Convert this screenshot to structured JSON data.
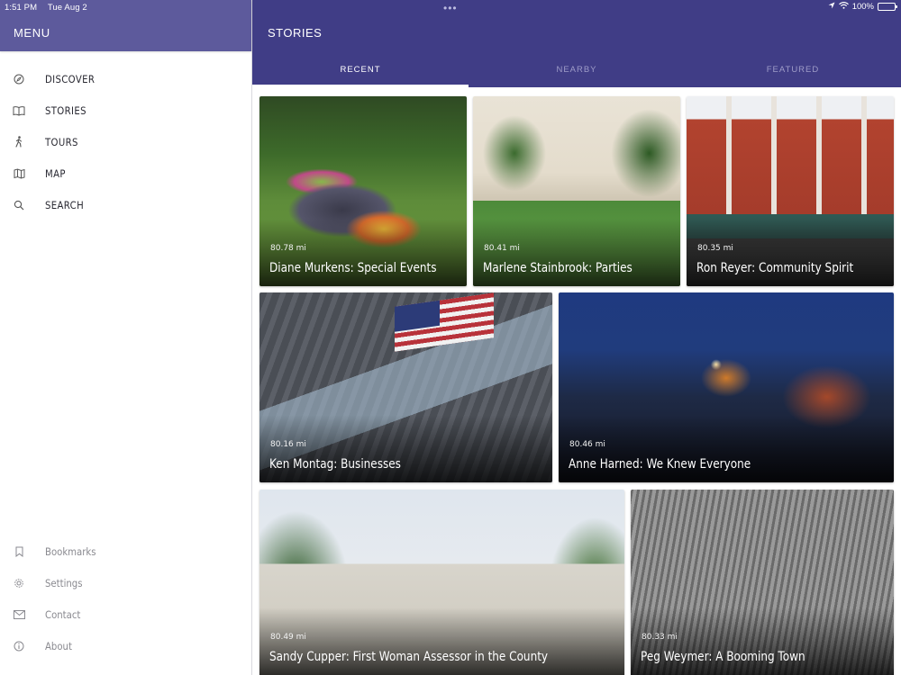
{
  "status_bar": {
    "time": "1:51 PM",
    "date": "Tue Aug 2",
    "battery": "100%",
    "battery_level": 1.0
  },
  "sidebar": {
    "title": "MENU",
    "main_items": [
      {
        "label": "DISCOVER",
        "icon": "compass-icon"
      },
      {
        "label": "STORIES",
        "icon": "book-icon"
      },
      {
        "label": "TOURS",
        "icon": "walking-person-icon"
      },
      {
        "label": "MAP",
        "icon": "map-icon"
      },
      {
        "label": "SEARCH",
        "icon": "search-icon"
      }
    ],
    "secondary_items": [
      {
        "label": "Bookmarks",
        "icon": "bookmark-icon"
      },
      {
        "label": "Settings",
        "icon": "gear-icon"
      },
      {
        "label": "Contact",
        "icon": "envelope-icon"
      },
      {
        "label": "About",
        "icon": "info-icon"
      }
    ]
  },
  "header": {
    "title": "STORIES",
    "tabs": [
      {
        "label": "RECENT",
        "active": true
      },
      {
        "label": "NEARBY",
        "active": false
      },
      {
        "label": "FEATURED",
        "active": false
      }
    ]
  },
  "stories": [
    {
      "title": "Diane Murkens: Special Events",
      "distance": "80.78 mi"
    },
    {
      "title": "Marlene Stainbrook: Parties",
      "distance": "80.41 mi"
    },
    {
      "title": "Ron Reyer: Community Spirit",
      "distance": "80.35 mi"
    },
    {
      "title": "Ken Montag: Businesses",
      "distance": "80.16 mi"
    },
    {
      "title": "Anne Harned: We Knew Everyone",
      "distance": "80.46 mi"
    },
    {
      "title": "Sandy Cupper: First Woman Assessor in the County",
      "distance": "80.49 mi"
    },
    {
      "title": "Peg Weymer: A Booming Town",
      "distance": "80.33 mi"
    }
  ],
  "colors": {
    "sidebar_header": "#5d5a9c",
    "main_header": "#403d86",
    "tab_inactive": "#9e9cc8"
  }
}
